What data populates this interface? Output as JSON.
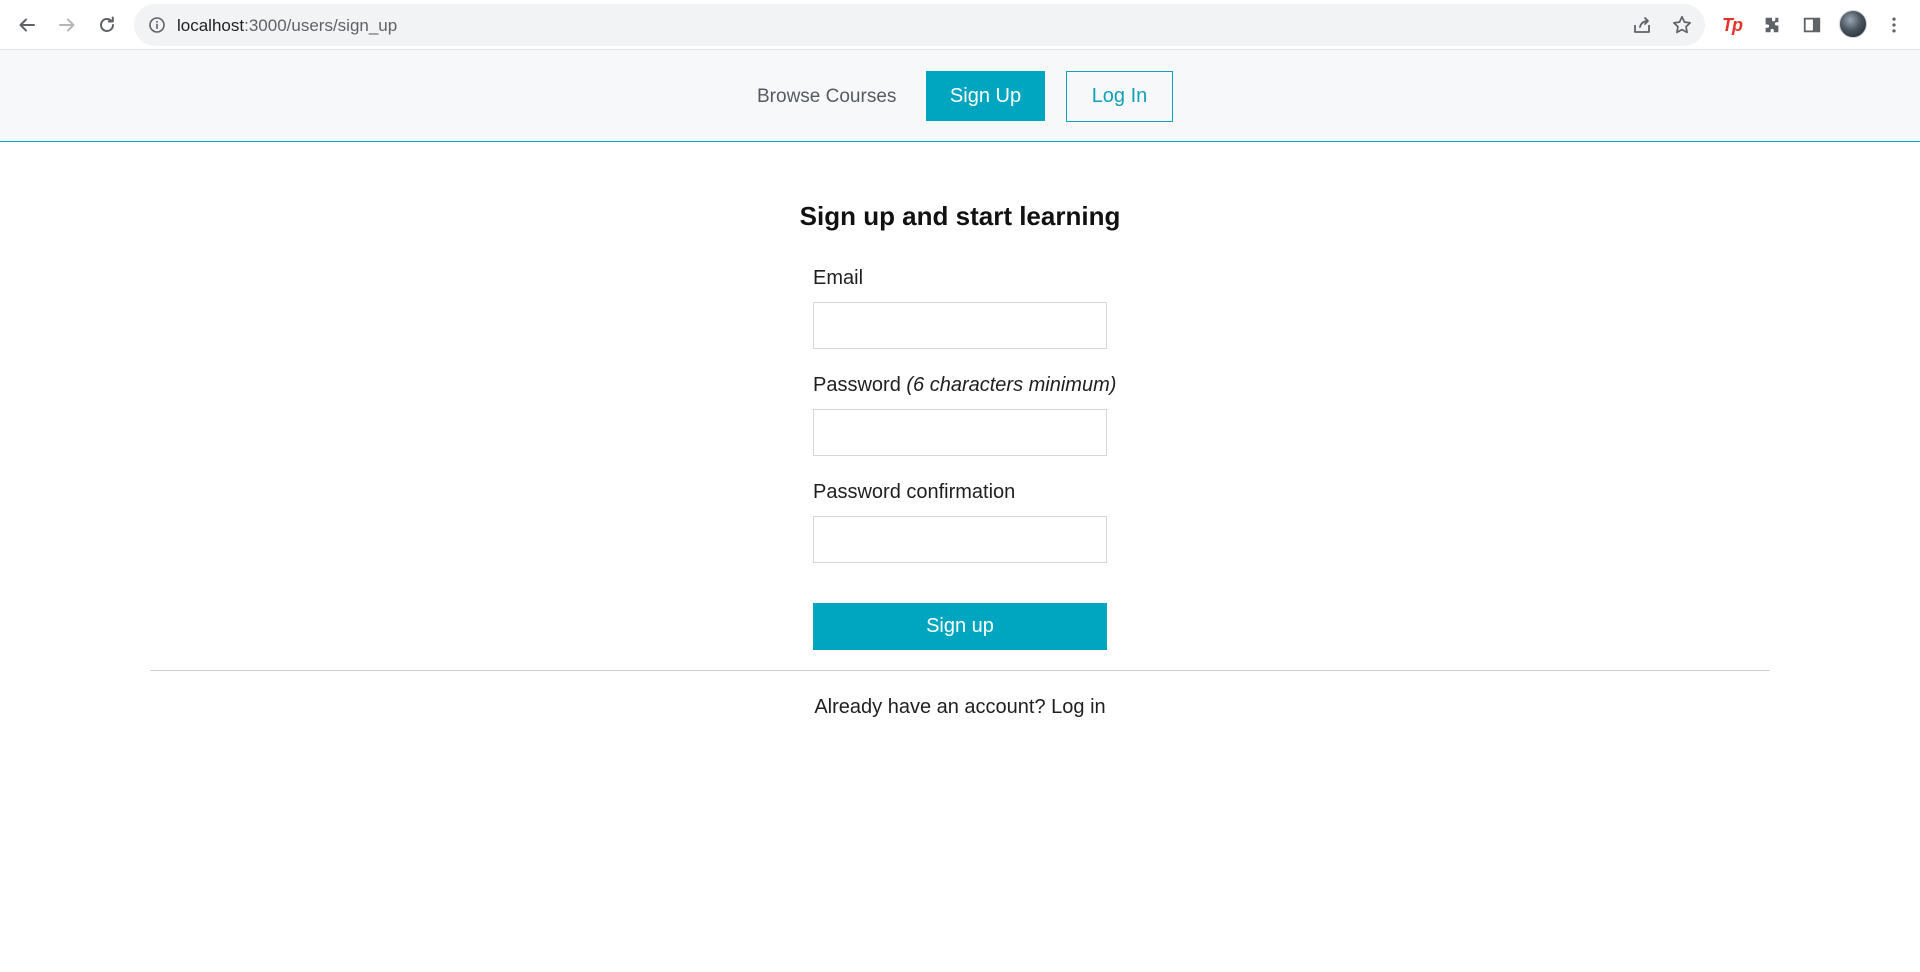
{
  "browser": {
    "url_host": "localhost",
    "url_path": ":3000/users/sign_up",
    "extension_label": "Tp",
    "icons": {
      "back": "arrow-left-icon",
      "forward": "arrow-right-icon",
      "reload": "reload-icon",
      "site_info": "info-icon",
      "share": "share-icon",
      "bookmark": "star-icon",
      "extensions": "puzzle-icon",
      "side_panel": "side-panel-icon",
      "menu": "kebab-menu-icon"
    }
  },
  "header": {
    "browse_label": "Browse Courses",
    "signup_label": "Sign Up",
    "login_label": "Log In",
    "accent_color": "#00a6c0"
  },
  "form": {
    "title": "Sign up and start learning",
    "email_label": "Email",
    "email_value": "",
    "password_label": "Password",
    "password_hint": "(6 characters minimum)",
    "password_value": "",
    "confirmation_label": "Password confirmation",
    "confirmation_value": "",
    "submit_label": "Sign up"
  },
  "footer": {
    "prompt": "Already have an account?",
    "login_link": "Log in"
  }
}
